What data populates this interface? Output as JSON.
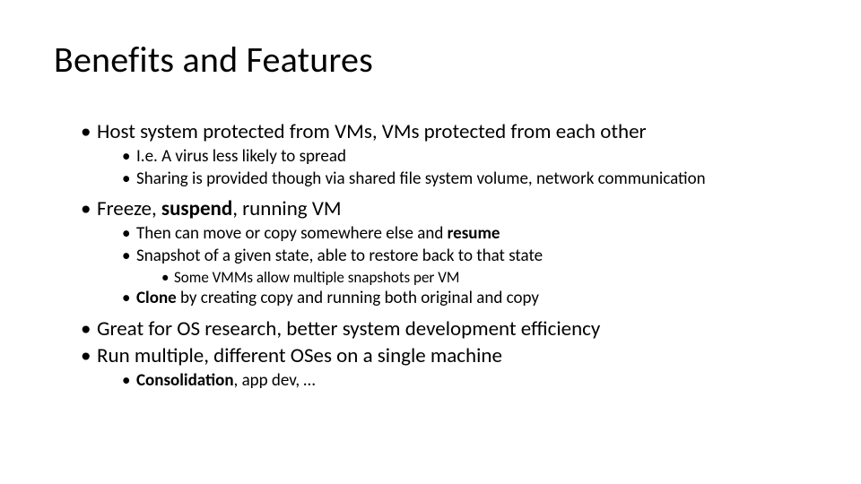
{
  "title": "Benefits and Features",
  "b1": {
    "l1_0": "Host system protected from VMs, VMs protected from each other",
    "l2_0": "I.e. A virus less likely to spread",
    "l2_1": "Sharing is provided though via shared file system volume, network communication"
  },
  "b2": {
    "l1_pre": "Freeze, ",
    "l1_bold": "suspend",
    "l1_post": ", running VM",
    "l2_0_pre": "Then can move or copy somewhere else and ",
    "l2_0_bold": "resume",
    "l2_1": "Snapshot of a given state, able to restore back to that state",
    "l3_0": "Some VMMs allow multiple snapshots per VM",
    "l2_2_bold": "Clone",
    "l2_2_post": " by creating copy and running both original and copy"
  },
  "b3": {
    "l1_0": "Great for OS research, better system development efficiency"
  },
  "b4": {
    "l1_0": "Run multiple, different OSes on a single machine",
    "l2_0_bold": "Consolidation",
    "l2_0_post": ", app dev, …"
  }
}
